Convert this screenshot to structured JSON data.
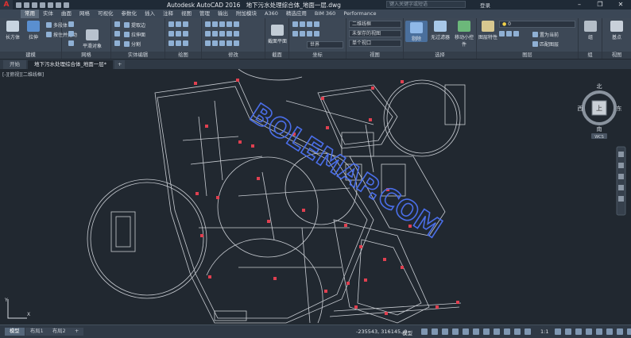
{
  "titlebar": {
    "app": "Autodesk AutoCAD 2016",
    "file": "地下污水处理综合体_地面一层.dwg",
    "search_placeholder": "键入关键字或短语",
    "login": "登录"
  },
  "ribbon_tabs": [
    "常用",
    "实体",
    "曲面",
    "网格",
    "可视化",
    "参数化",
    "插入",
    "注释",
    "视图",
    "管理",
    "输出",
    "附加模块",
    "A360",
    "精选应用",
    "BIM 360",
    "Performance"
  ],
  "ribbon_active": "常用",
  "panels": {
    "modeling": {
      "footer": "建模",
      "box": "长方体",
      "extrude": "拉伸",
      "polysolid": "多段体",
      "presspull": "按住并拖动"
    },
    "mesh": {
      "footer": "网格",
      "smooth": "平滑对象"
    },
    "solidedit": {
      "footer": "实体编辑",
      "extract": "提取边",
      "extrude_face": "拉伸面",
      "separate": "分割"
    },
    "draw": {
      "footer": "绘图"
    },
    "modify": {
      "footer": "修改"
    },
    "section": {
      "footer": "截面",
      "plane": "截面平面"
    },
    "coords": {
      "footer": "坐标"
    },
    "view": {
      "footer": "视图",
      "visual_style": "二维线框",
      "saved_view": "未保存的视图",
      "viewport": "单个视口",
      "world": "世界"
    },
    "selection": {
      "footer": "选择",
      "cull": "剔除",
      "nofilter": "无过滤器",
      "gizmo": "移动小控件"
    },
    "layers": {
      "footer": "图层",
      "props": "图层特性",
      "current": "置为当前",
      "match": "匹配图层",
      "layer0": "0"
    },
    "group": {
      "footer": "组",
      "label": "组"
    },
    "viewpanel": {
      "footer": "视图",
      "base": "基点"
    }
  },
  "doc_tabs": [
    "开始",
    "地下污水处理综合体_地面一层*"
  ],
  "viewport_label": "[-][俯视][二维线框]",
  "viewcube": {
    "north": "北",
    "south": "南",
    "east": "东",
    "west": "西",
    "top": "上",
    "wcs": "WCS"
  },
  "watermark": "BOLEMAP.COM",
  "ucs": {
    "x": "X",
    "y": "Y"
  },
  "status": {
    "layout_tabs": [
      "模型",
      "布局1",
      "布局2"
    ],
    "coords": "-235543, 316145, 0",
    "model": "模型",
    "scale": "1:1"
  },
  "colors": {
    "accent": "#2a87d0",
    "drawing": "#c8ccd2",
    "marker": "#e04050",
    "watermark": "#4a6ee8"
  }
}
